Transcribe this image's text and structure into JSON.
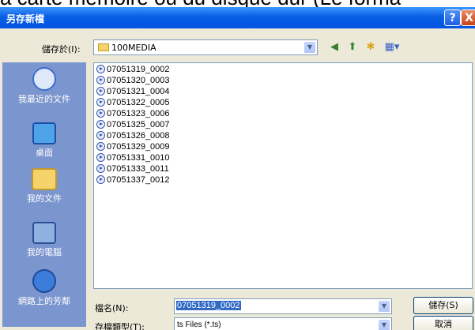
{
  "background_text": "a carte mémoire ou du disque dur (Le forma",
  "dialog": {
    "title": "另存新檔",
    "help_label": "?",
    "close_label": "X"
  },
  "toolbar": {
    "save_in_label": "儲存於(I):",
    "save_in_value": "100MEDIA",
    "back_icon": "back-arrow-icon",
    "up_icon": "up-folder-icon",
    "new_folder_icon": "new-folder-icon",
    "views_icon": "views-menu-icon"
  },
  "places": [
    {
      "label": "我最近的文件",
      "icon": "recent-documents-icon"
    },
    {
      "label": "桌面",
      "icon": "desktop-icon"
    },
    {
      "label": "我的文件",
      "icon": "my-documents-icon"
    },
    {
      "label": "我的電腦",
      "icon": "my-computer-icon"
    },
    {
      "label": "網路上的芳鄰",
      "icon": "network-places-icon"
    }
  ],
  "files": [
    "07051319_0002",
    "07051320_0003",
    "07051321_0004",
    "07051322_0005",
    "07051323_0006",
    "07051325_0007",
    "07051326_0008",
    "07051329_0009",
    "07051331_0010",
    "07051333_0011",
    "07051337_0012"
  ],
  "form": {
    "filename_label": "檔名(N):",
    "filename_value": "07051319_0002",
    "filetype_label": "存檔類型(T):",
    "filetype_value": "ts Files (*.ts)",
    "save_button": "儲存(S)",
    "cancel_button": "取消"
  },
  "colors": {
    "titlebar": "#0054e3",
    "places_bar": "#7b95ce",
    "dialog_bg": "#ece9d8",
    "selection": "#316ac5"
  }
}
